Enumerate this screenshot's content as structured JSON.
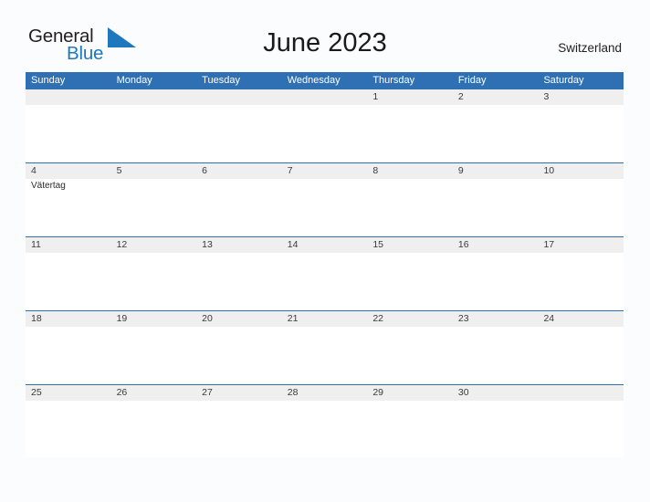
{
  "brand": {
    "name_part1": "General",
    "name_part2": "Blue",
    "flag_icon": "blue-flag-triangle",
    "color_dark": "#231f20",
    "color_blue": "#1f77bd"
  },
  "header": {
    "title": "June 2023",
    "country": "Switzerland"
  },
  "theme": {
    "header_blue": "#2e70b3",
    "row_band_gray": "#efefef",
    "page_background": "#fbfcfd"
  },
  "calendar": {
    "weekday_headers": [
      "Sunday",
      "Monday",
      "Tuesday",
      "Wednesday",
      "Thursday",
      "Friday",
      "Saturday"
    ],
    "weeks": [
      {
        "days": [
          {
            "date": "",
            "event": ""
          },
          {
            "date": "",
            "event": ""
          },
          {
            "date": "",
            "event": ""
          },
          {
            "date": "",
            "event": ""
          },
          {
            "date": "1",
            "event": ""
          },
          {
            "date": "2",
            "event": ""
          },
          {
            "date": "3",
            "event": ""
          }
        ]
      },
      {
        "days": [
          {
            "date": "4",
            "event": "Vätertag"
          },
          {
            "date": "5",
            "event": ""
          },
          {
            "date": "6",
            "event": ""
          },
          {
            "date": "7",
            "event": ""
          },
          {
            "date": "8",
            "event": ""
          },
          {
            "date": "9",
            "event": ""
          },
          {
            "date": "10",
            "event": ""
          }
        ]
      },
      {
        "days": [
          {
            "date": "11",
            "event": ""
          },
          {
            "date": "12",
            "event": ""
          },
          {
            "date": "13",
            "event": ""
          },
          {
            "date": "14",
            "event": ""
          },
          {
            "date": "15",
            "event": ""
          },
          {
            "date": "16",
            "event": ""
          },
          {
            "date": "17",
            "event": ""
          }
        ]
      },
      {
        "days": [
          {
            "date": "18",
            "event": ""
          },
          {
            "date": "19",
            "event": ""
          },
          {
            "date": "20",
            "event": ""
          },
          {
            "date": "21",
            "event": ""
          },
          {
            "date": "22",
            "event": ""
          },
          {
            "date": "23",
            "event": ""
          },
          {
            "date": "24",
            "event": ""
          }
        ]
      },
      {
        "days": [
          {
            "date": "25",
            "event": ""
          },
          {
            "date": "26",
            "event": ""
          },
          {
            "date": "27",
            "event": ""
          },
          {
            "date": "28",
            "event": ""
          },
          {
            "date": "29",
            "event": ""
          },
          {
            "date": "30",
            "event": ""
          },
          {
            "date": "",
            "event": ""
          }
        ]
      }
    ]
  }
}
